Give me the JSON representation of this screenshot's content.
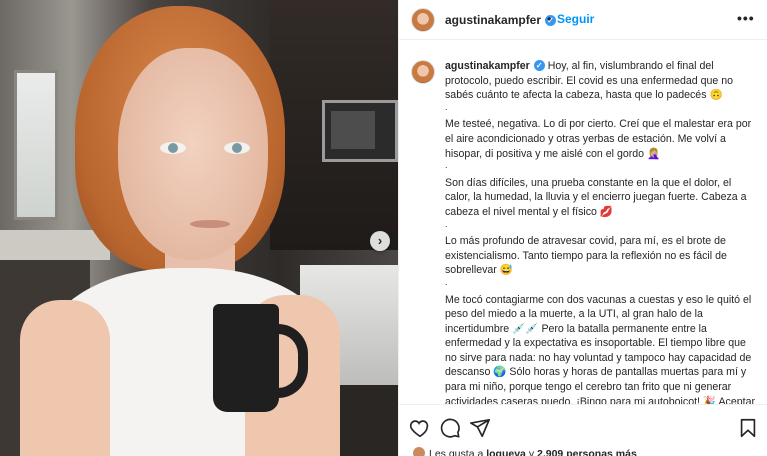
{
  "post": {
    "username": "agustinakampfer",
    "follow_label": "Seguir",
    "separator": "•",
    "more_label": "•••",
    "caption": [
      "Hoy, al fin, vislumbrando el final del protocolo, puedo escribir. El covid es una enfermedad que no sabés cuánto te afecta la cabeza, hasta que lo padecés 🙃",
      ".",
      "Me testeé, negativa. Lo di por cierto. Creí que el malestar era por el aire acondicionado y otras yerbas de estación. Me volví a hisopar, di positiva y me aislé con el gordo 🤦🏼‍♀️",
      ".",
      "Son días difíciles, una prueba constante en la que el dolor, el calor, la humedad, la lluvia y el encierro juegan fuerte. Cabeza a cabeza el nivel mental y el físico 💋",
      ".",
      "Lo más profundo de atravesar covid, para mí, es el brote de existencialismo. Tanto tiempo para la reflexión no es fácil de sobrellevar 😅",
      ".",
      "Me tocó contagiarme con dos vacunas a cuestas y eso le quitó el peso del miedo a la muerte, a la UTI, al gran halo de la incertidumbre 💉💉 Pero la batalla permanente entre la enfermedad y la expectativa es insoportable. El tiempo libre que no sirve para nada: no hay voluntad y tampoco hay capacidad de descanso 🌍 Sólo horas y horas de pantallas muertas para mí y para mi niño, porque tengo el cerebro tan frito que ni generar actividades caseras puedo. ¡Bingo para mi autoboicot! 🎉 Aceptar no poder no está en mi ADN; salgo a buscar eso mientras me tomo la fiebre y llamo amigas por teléfono para"
    ],
    "likes": {
      "prefix": "Les gusta a",
      "user": "loqueva",
      "conj": "y",
      "count": "2.909 personas más"
    }
  },
  "photo": {
    "next_label": "›"
  },
  "icons": {
    "verified": "verified-badge-icon",
    "like": "heart-icon",
    "comment": "comment-icon",
    "share": "send-icon",
    "save": "bookmark-icon"
  },
  "colors": {
    "accent": "#0095f6",
    "verified": "#3897f0",
    "text": "#262626",
    "border": "#efefef"
  }
}
